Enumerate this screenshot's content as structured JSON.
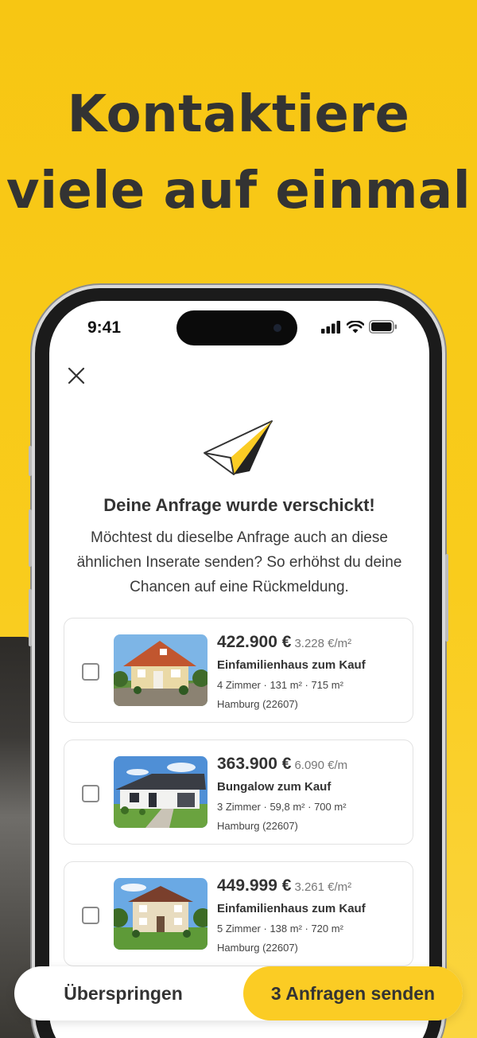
{
  "headline": {
    "line1": "Kontaktiere",
    "line2": "viele auf einmal"
  },
  "status_bar": {
    "time": "9:41"
  },
  "dialog": {
    "title": "Deine Anfrage wurde verschickt!",
    "subtitle": "Möchtest du dieselbe Anfrage auch an diese ähnlichen Inserate senden? So erhöhst du deine Chancen auf eine Rückmeldung."
  },
  "listings": [
    {
      "price": "422.900 €",
      "price_per_sqm": "3.228 €/m²",
      "type": "Einfamilienhaus zum Kauf",
      "specs": "4 Zimmer · 131 m² · 715 m²",
      "location": "Hamburg (22607)",
      "checked": false
    },
    {
      "price": "363.900 €",
      "price_per_sqm": "6.090 €/m",
      "type": "Bungalow zum Kauf",
      "specs": "3 Zimmer · 59,8 m² · 700 m²",
      "location": "Hamburg (22607)",
      "checked": false
    },
    {
      "price": "449.999 €",
      "price_per_sqm": "3.261 €/m²",
      "type": "Einfamilienhaus zum Kauf",
      "specs": "5 Zimmer · 138 m² · 720 m²",
      "location": "Hamburg (22607)",
      "checked": false
    }
  ],
  "actions": {
    "skip_label": "Überspringen",
    "send_label": "3 Anfragen senden"
  },
  "colors": {
    "brand_yellow": "#f7c613",
    "button_yellow": "#fbcc24",
    "text_dark": "#333333"
  },
  "icons": {
    "close": "close-icon",
    "plane": "paper-plane-icon",
    "signal": "signal-icon",
    "wifi": "wifi-icon",
    "battery": "battery-icon"
  }
}
